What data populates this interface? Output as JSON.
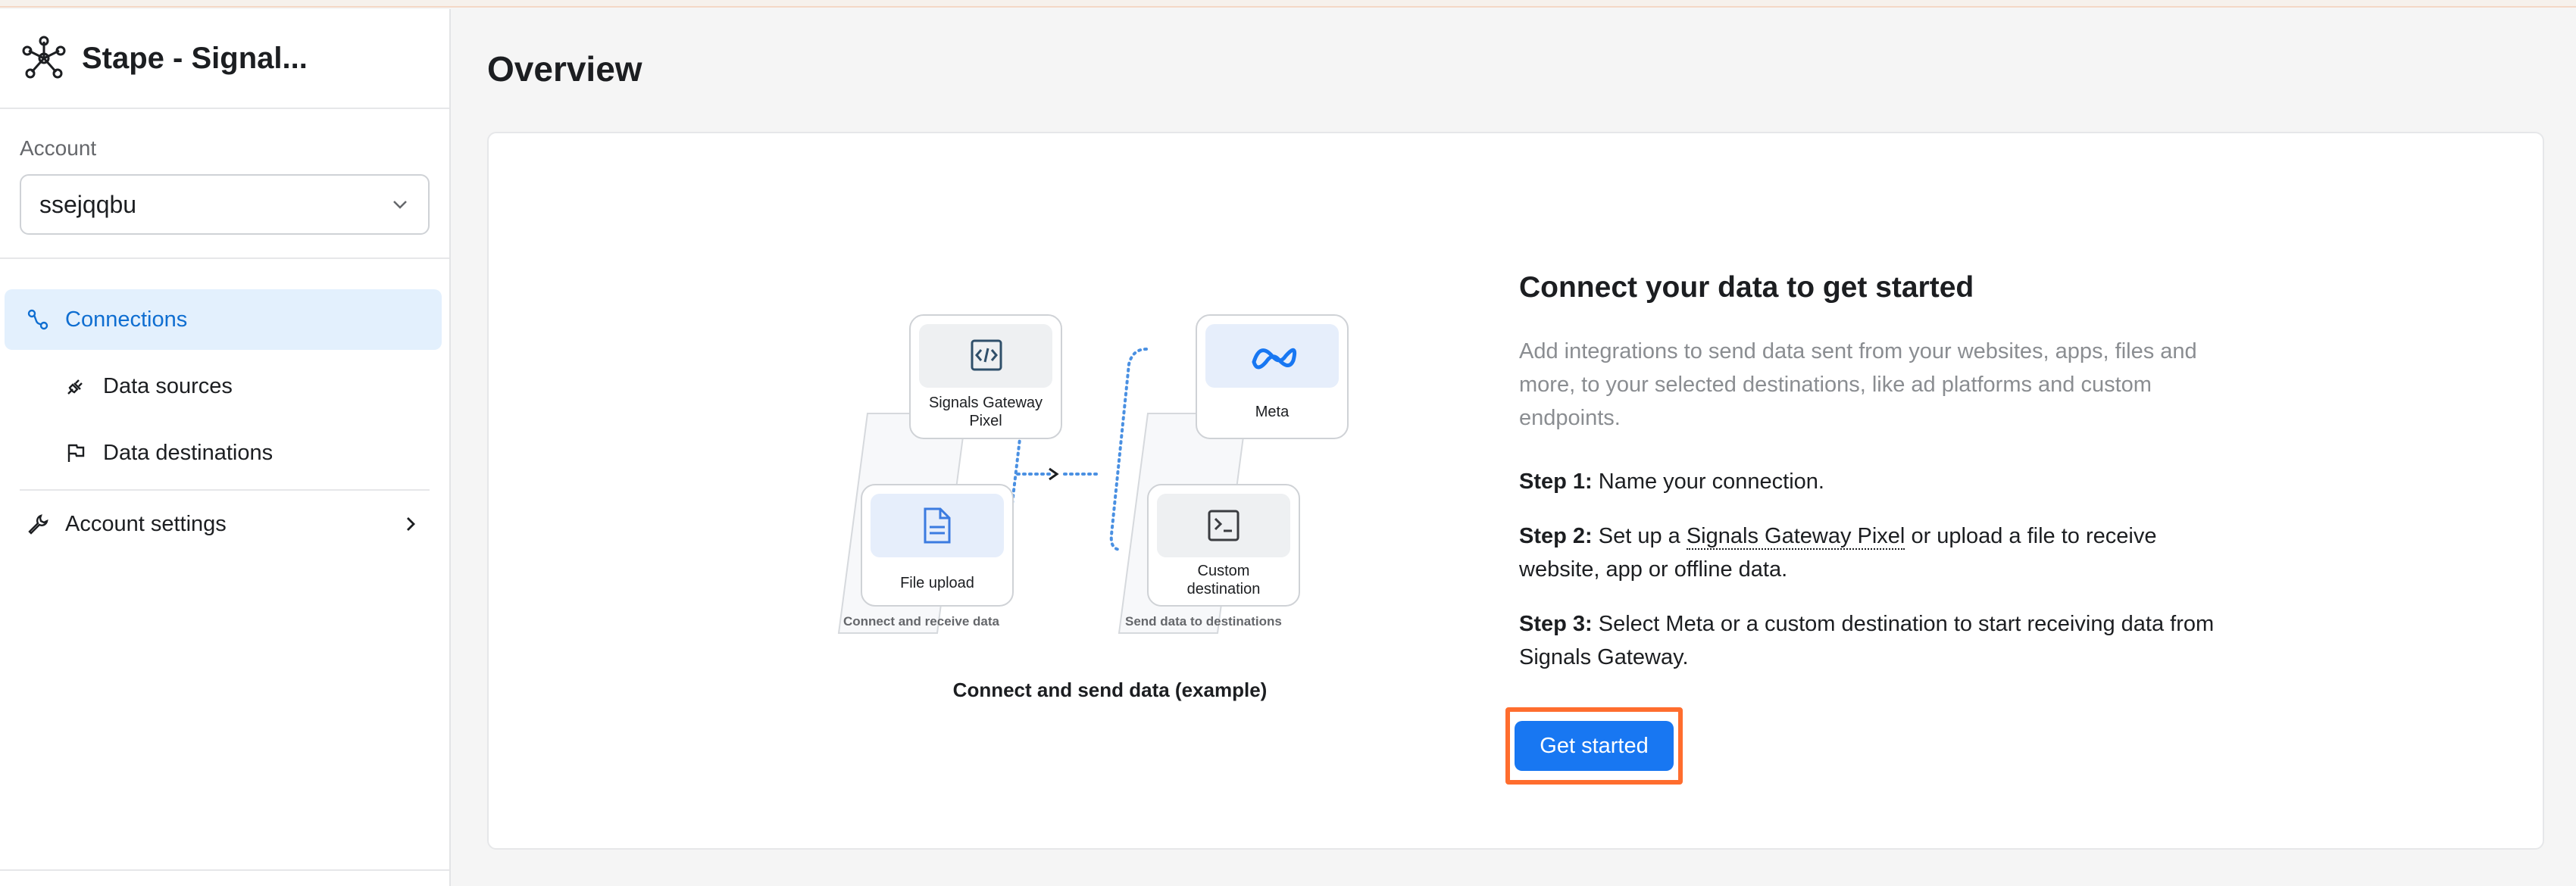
{
  "app": {
    "name": "Stape - Signal..."
  },
  "account": {
    "label": "Account",
    "value": "ssejqqbu"
  },
  "nav": {
    "connections": "Connections",
    "data_sources": "Data sources",
    "data_destinations": "Data destinations",
    "account_settings": "Account settings"
  },
  "page": {
    "title": "Overview"
  },
  "illustration": {
    "signals_gateway_pixel": "Signals Gateway Pixel",
    "file_upload": "File upload",
    "meta": "Meta",
    "custom_destination": "Custom destination",
    "connect_receive": "Connect and receive data",
    "send_destinations": "Send data to destinations",
    "caption": "Connect and send data (example)"
  },
  "connect": {
    "heading": "Connect your data to get started",
    "description": "Add integrations to send data sent from your websites, apps, files and more, to your selected destinations, like ad platforms and custom endpoints.",
    "step1_label": "Step 1:",
    "step1_text": "Name your connection.",
    "step2_label": "Step 2:",
    "step2_pre": "Set up a",
    "step2_link": "Signals Gateway Pixel",
    "step2_post": "or upload a file to receive website, app or offline data.",
    "step3_label": "Step 3:",
    "step3_text": "Select Meta or a custom destination to start receiving data from Signals Gateway.",
    "button": "Get started"
  },
  "colors": {
    "accent": "#1877f2",
    "active_nav_bg": "#e3f0fd",
    "highlight": "#ff6d2e"
  }
}
